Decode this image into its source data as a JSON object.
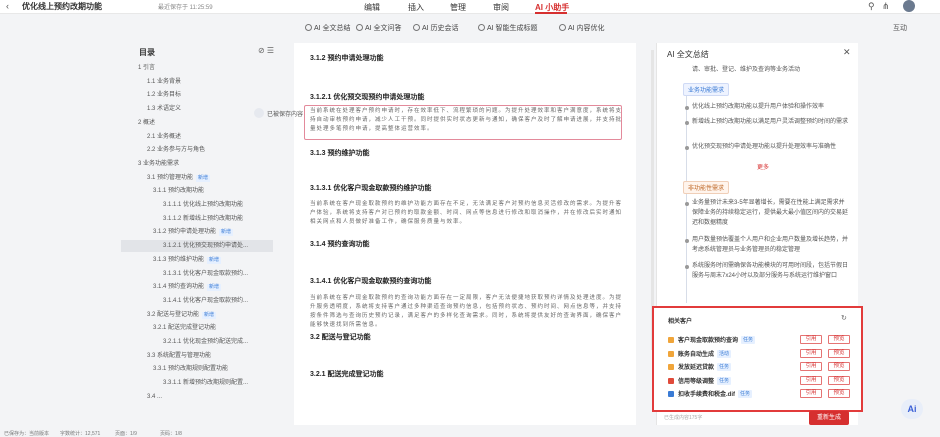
{
  "topbar": {
    "back_icon": "chevron-left-icon",
    "doc_title": "优化线上预约改期功能",
    "saved_text": "最近保存于 11:25:59",
    "menu": [
      "编辑",
      "插入",
      "管理",
      "审阅",
      "AI 小助手"
    ],
    "active_menu": "AI 小助手",
    "accent": "#d62f2f"
  },
  "toolbar": {
    "tools": [
      "AI 全文总结",
      "AI 全文问答",
      "AI 历史会话",
      "AI 智能生成标题",
      "AI 内容优化"
    ],
    "right_label": "互动"
  },
  "toc": {
    "title": "目录",
    "items": [
      {
        "label": "1 引言",
        "level": 1
      },
      {
        "label": "1.1 业务背景",
        "level": 2
      },
      {
        "label": "1.2 业务目标",
        "level": 2
      },
      {
        "label": "1.3 术语定义",
        "level": 2
      },
      {
        "label": "2 概述",
        "level": 1
      },
      {
        "label": "2.1 业务概述",
        "level": 2
      },
      {
        "label": "2.2 业务参与方与角色",
        "level": 2
      },
      {
        "label": "3 业务功能需求",
        "level": 1
      },
      {
        "label": "3.1 预约管理功能",
        "level": 2,
        "badge": "新增"
      },
      {
        "label": "3.1.1 预约改期功能",
        "level": 3
      },
      {
        "label": "3.1.1.1 优化线上预约改期功能",
        "level": 4
      },
      {
        "label": "3.1.1.2 新增线上预约改期功能",
        "level": 4
      },
      {
        "label": "3.1.2 预约申请处理功能",
        "level": 3,
        "badge": "新增"
      },
      {
        "label": "3.1.2.1 优化预交现预约申请处...",
        "level": 4,
        "selected": true
      },
      {
        "label": "3.1.3 预约维护功能",
        "level": 3,
        "badge": "新增"
      },
      {
        "label": "3.1.3.1 优化客户现金取款预约...",
        "level": 4
      },
      {
        "label": "3.1.4 预约查询功能",
        "level": 3,
        "badge": "新增"
      },
      {
        "label": "3.1.4.1 优化客户现金取款预约...",
        "level": 4
      },
      {
        "label": "3.2 配送与登记功能",
        "level": 2,
        "badge": "新增"
      },
      {
        "label": "3.2.1 配送完成登记功能",
        "level": 3
      },
      {
        "label": "3.2.1.1 优化现金预约配送完成...",
        "level": 4
      },
      {
        "label": "3.3 系统配置与管理功能",
        "level": 2
      },
      {
        "label": "3.3.1 预约改期规则配置功能",
        "level": 3
      },
      {
        "label": "3.3.1.1 新增预约改期规则配置...",
        "level": 4
      },
      {
        "label": "3.4 ...",
        "level": 2
      }
    ]
  },
  "doc": {
    "h_312": "3.1.2 预约申请处理功能",
    "h_3121": "3.1.2.1 优化预交现预约申请处理功能",
    "p_3121": "当前系统在处理客户预约申请时，存在效率低下、流程繁琐的问题。为提升处理效率和客户满意度，系统将支持自动审核预约申请，减少人工干预。同时提供实时状态更新与通知，确保客户及时了解申请进展，并支持批量处理多笔预约申请，提高整体运营效率。",
    "h_313": "3.1.3 预约维护功能",
    "h_3131": "3.1.3.1 优化客户现金取款预约维护功能",
    "p_3131": "当前系统在客户现金取款预约的维护功能方面存在不足，无法满足客户对预约信息灵活修改的需求。为提升客户体验，系统将支持客户对已预约的取款金额、时间、网点等信息进行修改和取消操作，并在修改后实时通知相关网点和人员做好准备工作，确保服务质量与效率。",
    "h_314": "3.1.4 预约查询功能",
    "h_3141": "3.1.4.1 优化客户现金取款预约查询功能",
    "p_3141": "当前系统在客户现金取款预约的查询功能方面存在一定局限，客户无法便捷地获取预约详情及处理进度。为提升服务透明度，系统将支持客户通过多种渠道查询预约信息，包括预约状态、预约时间、网点信息等，并支持按条件筛选与查询历史预约记录，满足客户的多样化查询需求。同时，系统将提供友好的查询界面，确保客户能够快速找到所需信息。",
    "h_32": "3.2 配送与登记功能",
    "h_321": "3.2.1 配送完成登记功能"
  },
  "comment": {
    "label": "已被保存内容"
  },
  "ai_panel": {
    "title": "AI 全文总结",
    "intro_line": "请、审批、登记、维护及查询等业务活动",
    "tag1": "业务功能需求",
    "points1": [
      "优化线上预约改期功能以提升用户体验和操作效率",
      "新增线上预约改期功能以满足用户灵活调整预约时间的需求",
      "优化预交现预约申请处理功能以提升处理效率与准确性"
    ],
    "more": "更多",
    "tag2": "非功能性需求",
    "points2": [
      "业务量预计未来3-5年显著增长，需要在性能上满足需求并保障业务的持续稳定运行，提供最大最小值区间内的交易延迟和数据精度",
      "用户数量预估覆盖个人用户和企业用户数量及增长趋势，并考虑系统管理员与业务管理员的稳定管理",
      "系统服务时间需确保各功能模块的可用时间段，包括节假日服务与周末7x24小时以及部分服务与系统运行维护窗口"
    ]
  },
  "related": {
    "title": "相关客户",
    "btn_cite": "引用",
    "btn_preview": "预览",
    "rows": [
      {
        "name": "客户现金取款预约查询",
        "tag": "任务",
        "tag_color": "blue",
        "icon_color": "#f0a53a"
      },
      {
        "name": "账务自动生成",
        "tag": "活动",
        "tag_color": "blue",
        "icon_color": "#f0a53a"
      },
      {
        "name": "发放延迟贷款",
        "tag": "任务",
        "tag_color": "blue",
        "icon_color": "#f0a53a"
      },
      {
        "name": "信用等级调整",
        "tag": "任务",
        "tag_color": "blue",
        "icon_color": "#e04a3a"
      },
      {
        "name": "扣收手续费和税金.dif",
        "tag": "任务",
        "tag_color": "blue",
        "icon_color": "#3a7bd5"
      }
    ]
  },
  "footer": {
    "ai_disclaimer": "已生成内容175字",
    "regen_label": "重新生成",
    "fab_label": "Ai",
    "status_items": [
      "已保存为：当前版本",
      "字数统计：12,571",
      "页面：1/9",
      "页码：1/8"
    ]
  }
}
